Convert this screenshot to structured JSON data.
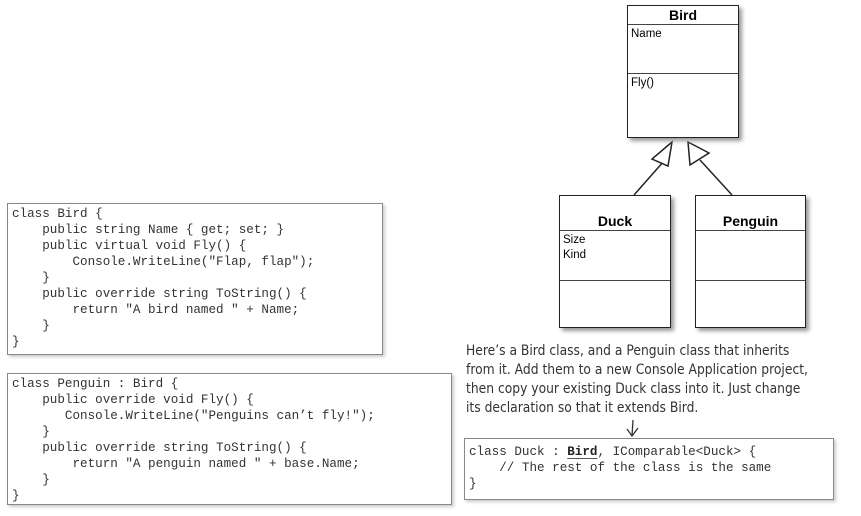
{
  "uml": {
    "bird": {
      "name": "Bird",
      "attributes": [
        "Name"
      ],
      "methods": [
        "Fly()"
      ]
    },
    "duck": {
      "name": "Duck",
      "attributes": [
        "Size",
        "Kind"
      ],
      "methods": []
    },
    "penguin": {
      "name": "Penguin",
      "attributes": [],
      "methods": []
    }
  },
  "bird_code": [
    "class Bird {",
    "    public string Name { get; set; }",
    "    public virtual void Fly() {",
    "        Console.WriteLine(\"Flap, flap\");",
    "    }",
    "    public override string ToString() {",
    "        return \"A bird named \" + Name;",
    "    }",
    "}"
  ],
  "penguin_code": [
    "class Penguin : Bird {",
    "    public override void Fly() {",
    "       Console.WriteLine(\"Penguins can’t fly!\");",
    "    }",
    "    public override string ToString() {",
    "        return \"A penguin named \" + base.Name;",
    "    }",
    "}"
  ],
  "note": [
    "Here’s a Bird class, and a Penguin class that inherits",
    "from it. Add them to a new Console Application project,",
    "then copy your existing Duck class into it. Just change",
    "its declaration so that it extends Bird."
  ],
  "duck_code": {
    "prefix": "class Duck : ",
    "highlight": "Bird",
    "suffix": ", IComparable<Duck> {",
    "line2": "    // The rest of the class is the same",
    "line3": "}"
  }
}
